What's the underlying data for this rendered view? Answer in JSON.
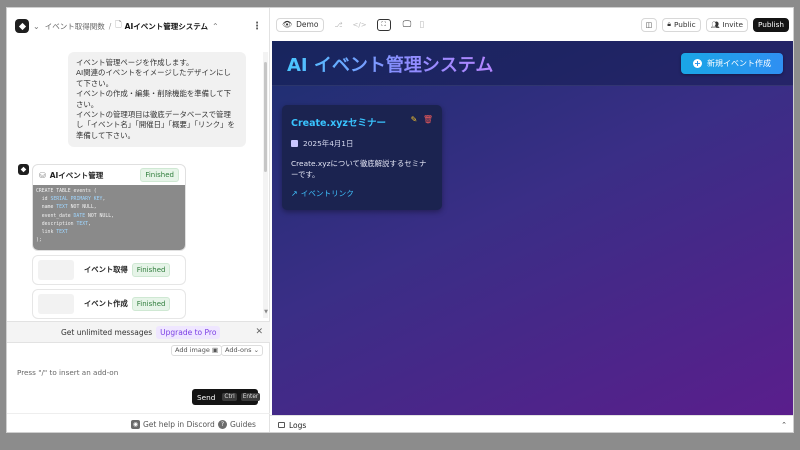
{
  "topbar": {
    "breadcrumb_parent": "イベント取得関数",
    "breadcrumb_current": "AIイベント管理システム"
  },
  "chat": {
    "user_message": "イベント管理ページを作成します。\nAI関連のイベントをイメージしたデザインにして下さい。\nイベントの作成・編集・削除機能を準備して下さい。\nイベントの管理項目は徹底データベースで管理し「イベント名」「開催日」「概要」「リンク」を準備して下さい。",
    "task_title": "AIイベント管理",
    "task_status": "Finished",
    "code": "CREATE TABLE events (\n  id SERIAL PRIMARY KEY,\n  name TEXT NOT NULL,\n  event_date DATE NOT NULL,\n  description TEXT,\n  link TEXT\n);",
    "subtasks": [
      {
        "label": "イベント取得",
        "status": "Finished"
      },
      {
        "label": "イベント作成",
        "status": "Finished"
      }
    ]
  },
  "upgrade": {
    "text": "Get unlimited messages",
    "link": "Upgrade to Pro"
  },
  "composer": {
    "add_image": "Add image",
    "addons": "Add-ons",
    "placeholder": "Press \"/\" to insert an add-on",
    "send": "Send",
    "kbd_ctrl": "Ctrl",
    "kbd_enter": "Enter"
  },
  "footer": {
    "discord": "Get help in Discord",
    "guides": "Guides"
  },
  "right_toolbar": {
    "demo": "Demo",
    "public": "Public",
    "invite": "Invite",
    "publish": "Publish"
  },
  "preview": {
    "title": "AI イベント管理システム",
    "new_button": "新規イベント作成",
    "events": [
      {
        "title": "Create.xyzセミナー",
        "date": "2025年4月1日",
        "description": "Create.xyzについて徹底解説するセミナーです。",
        "link": "イベントリンク"
      }
    ],
    "accent": "#39c4ff"
  },
  "logs": {
    "label": "Logs"
  }
}
